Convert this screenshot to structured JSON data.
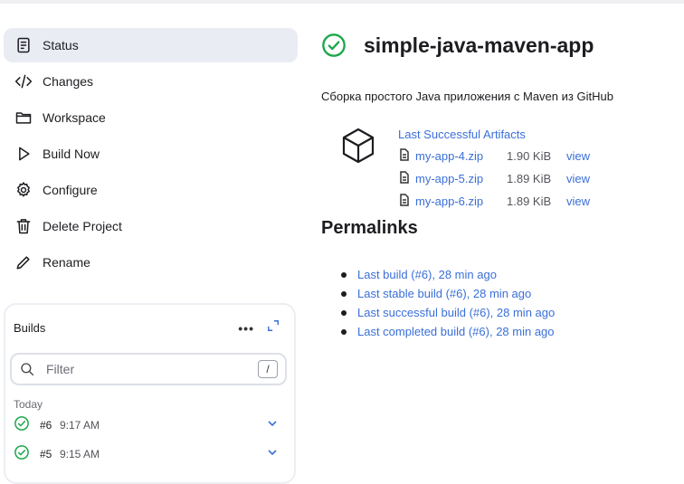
{
  "colors": {
    "accent": "#3a6fd8",
    "success": "#1ea64c",
    "active_bg": "#e9ecf3"
  },
  "sidebar": {
    "items": [
      {
        "label": "Status",
        "icon": "document-icon",
        "active": true
      },
      {
        "label": "Changes",
        "icon": "code-icon"
      },
      {
        "label": "Workspace",
        "icon": "folder-icon"
      },
      {
        "label": "Build Now",
        "icon": "play-icon"
      },
      {
        "label": "Configure",
        "icon": "gear-icon"
      },
      {
        "label": "Delete Project",
        "icon": "trash-icon"
      },
      {
        "label": "Rename",
        "icon": "pencil-icon"
      }
    ]
  },
  "builds": {
    "title": "Builds",
    "more_label": "•••",
    "filter_placeholder": "Filter",
    "filter_shortcut": "/",
    "group_label": "Today",
    "items": [
      {
        "number": "#6",
        "time": "9:17 AM",
        "status": "success"
      },
      {
        "number": "#5",
        "time": "9:15 AM",
        "status": "success"
      }
    ]
  },
  "main": {
    "title": "simple-java-maven-app",
    "description": "Сборка простого Java приложения с Maven из GitHub",
    "artifacts": {
      "heading": "Last Successful Artifacts",
      "files": [
        {
          "name": "my-app-4.zip",
          "size": "1.90 KiB",
          "action": "view"
        },
        {
          "name": "my-app-5.zip",
          "size": "1.89 KiB",
          "action": "view"
        },
        {
          "name": "my-app-6.zip",
          "size": "1.89 KiB",
          "action": "view"
        }
      ]
    },
    "permalinks_title": "Permalinks",
    "permalinks": [
      "Last build (#6), 28 min ago",
      "Last stable build (#6), 28 min ago",
      "Last successful build (#6), 28 min ago",
      "Last completed build (#6), 28 min ago"
    ]
  }
}
